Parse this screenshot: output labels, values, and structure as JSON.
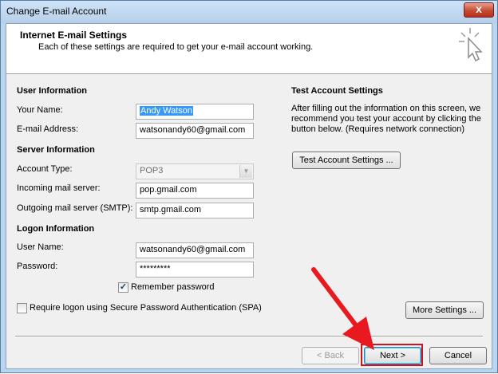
{
  "window": {
    "title": "Change E-mail Account",
    "close_label": "x"
  },
  "header": {
    "title": "Internet E-mail Settings",
    "subtitle": "Each of these settings are required to get your e-mail account working."
  },
  "user_info": {
    "heading": "User Information",
    "your_name_label": "Your Name:",
    "your_name_value": "Andy Watson",
    "email_label": "E-mail Address:",
    "email_value": "watsonandy60@gmail.com"
  },
  "server_info": {
    "heading": "Server Information",
    "account_type_label": "Account Type:",
    "account_type_value": "POP3",
    "incoming_label": "Incoming mail server:",
    "incoming_value": "pop.gmail.com",
    "outgoing_label": "Outgoing mail server (SMTP):",
    "outgoing_value": "smtp.gmail.com"
  },
  "logon_info": {
    "heading": "Logon Information",
    "username_label": "User Name:",
    "username_value": "watsonandy60@gmail.com",
    "password_label": "Password:",
    "password_value": "*********",
    "remember_label": "Remember password",
    "remember_checked": true,
    "spa_label": "Require logon using Secure Password Authentication (SPA)",
    "spa_checked": false
  },
  "test_settings": {
    "heading": "Test Account Settings",
    "description": "After filling out the information on this screen, we recommend you test your account by clicking the button below. (Requires network connection)",
    "button_label": "Test Account Settings ..."
  },
  "more_settings_label": "More Settings ...",
  "footer": {
    "back_label": "< Back",
    "next_label": "Next >",
    "cancel_label": "Cancel"
  },
  "colors": {
    "annotation_red": "#e8191f",
    "selection": "#3399ff"
  }
}
